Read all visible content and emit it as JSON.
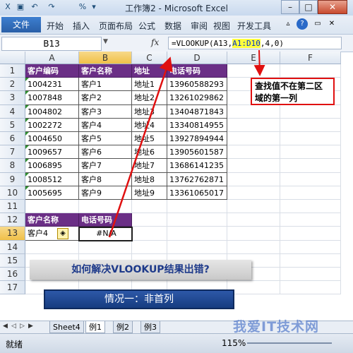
{
  "window": {
    "title": "工作簿2 - Microsoft Excel",
    "minimize_label": "–",
    "maximize_label": "□",
    "close_label": "✕"
  },
  "quick_access": {
    "undo_label": "↶",
    "redo_label": "↷",
    "percent_label": "%",
    "more_label": "▾"
  },
  "menu": {
    "file_label": "文件",
    "items": [
      "开始",
      "插入",
      "页面布局",
      "公式",
      "数据",
      "审阅",
      "视图",
      "开发工具"
    ]
  },
  "formula_bar": {
    "name_box": "B13",
    "fx_label": "fx",
    "formula_prefix": "=VLOOKUP(A13,",
    "formula_range": "A1:D10",
    "formula_suffix": ",4,0)"
  },
  "columns": [
    "A",
    "B",
    "C",
    "D",
    "E",
    "F"
  ],
  "rows": [
    "1",
    "2",
    "3",
    "4",
    "5",
    "6",
    "7",
    "8",
    "9",
    "10",
    "11",
    "12",
    "13",
    "14",
    "15",
    "16",
    "17"
  ],
  "table": {
    "headers": [
      "客户编码",
      "客户名称",
      "地址",
      "电话号码"
    ],
    "rows": [
      [
        "1004231",
        "客户1",
        "地址1",
        "13960588293"
      ],
      [
        "1007848",
        "客户2",
        "地址2",
        "13261029862"
      ],
      [
        "1004802",
        "客户3",
        "地址3",
        "13404871843"
      ],
      [
        "1002272",
        "客户4",
        "地址4",
        "13340814955"
      ],
      [
        "1004650",
        "客户5",
        "地址5",
        "13927894944"
      ],
      [
        "1009657",
        "客户6",
        "地址6",
        "13905601587"
      ],
      [
        "1006895",
        "客户7",
        "地址7",
        "13686141235"
      ],
      [
        "1008512",
        "客户8",
        "地址8",
        "13762762871"
      ],
      [
        "1005695",
        "客户9",
        "地址9",
        "13361065017"
      ]
    ]
  },
  "lookup": {
    "header_a": "客户名称",
    "header_b": "电话号码",
    "value_a": "客户4",
    "value_b": "#N/A",
    "error_icon": "◈"
  },
  "callout_text": "查找值不在第二区域的第一列",
  "banner_text": "如何解决VLOOKUP结果出错?",
  "subbanner_text": "情况一：非首列",
  "sheet_tabs": [
    "Sheet4",
    "例1",
    "例2",
    "例3"
  ],
  "status": {
    "mode": "就绪",
    "zoom": "115%"
  },
  "watermark_text": "我爱IT技术网",
  "colors": {
    "header_purple": "#6b2f86",
    "highlight_yellow": "#ffff3c",
    "arrow_red": "#e01010",
    "banner_blue": "#1e3a8a"
  }
}
